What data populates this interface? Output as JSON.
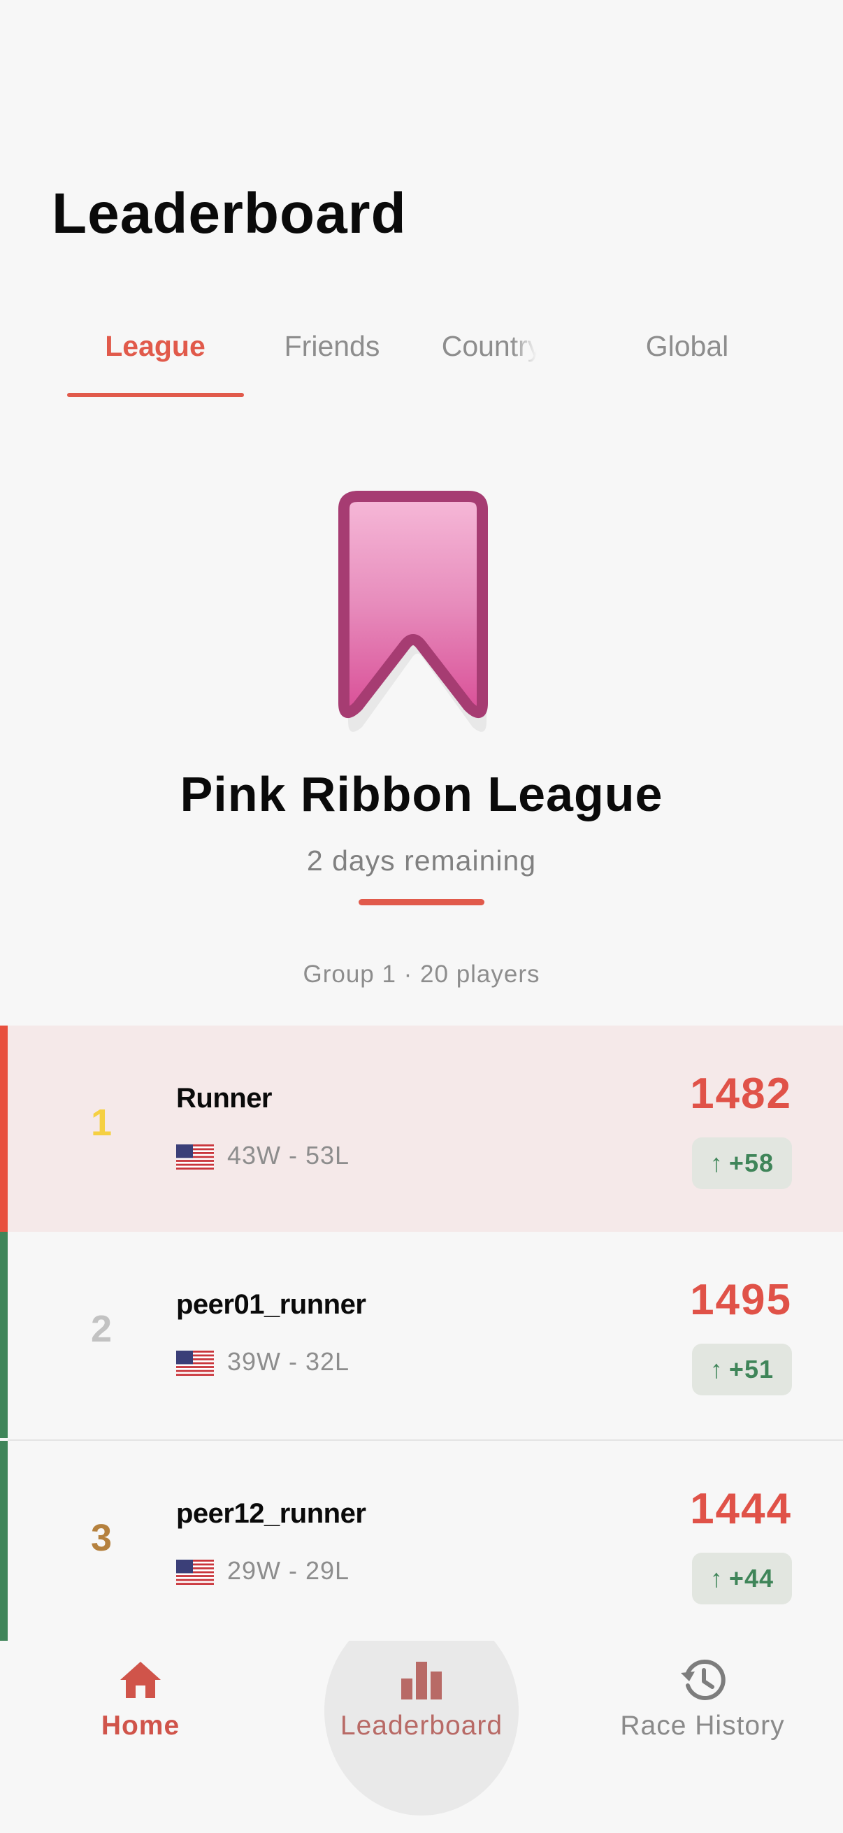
{
  "header": {
    "title": "Leaderboard"
  },
  "tabs": [
    {
      "label": "League",
      "active": true
    },
    {
      "label": "Friends",
      "active": false
    },
    {
      "label": "Country",
      "active": false
    },
    {
      "label": "Global",
      "active": false
    }
  ],
  "league": {
    "name": "Pink Ribbon League",
    "remaining": "2 days remaining",
    "group_info": "Group 1 · 20 players",
    "badge_icon": "ribbon-badge-icon"
  },
  "rows": [
    {
      "rank": "1",
      "name": "Runner",
      "record": "43W - 53L",
      "score": "1482",
      "delta": "+58",
      "flag_icon": "us-flag-icon",
      "is_me": true
    },
    {
      "rank": "2",
      "name": "peer01_runner",
      "record": "39W - 32L",
      "score": "1495",
      "delta": "+51",
      "flag_icon": "us-flag-icon",
      "is_me": false
    },
    {
      "rank": "3",
      "name": "peer12_runner",
      "record": "29W - 29L",
      "score": "1444",
      "delta": "+44",
      "flag_icon": "us-flag-icon",
      "is_me": false
    }
  ],
  "nav": [
    {
      "label": "Home",
      "icon": "home-icon",
      "active": false
    },
    {
      "label": "Leaderboard",
      "icon": "bar-chart-icon",
      "active": true
    },
    {
      "label": "Race History",
      "icon": "history-icon",
      "active": false
    }
  ],
  "colors": {
    "accent": "#e15a4b",
    "score": "#e05248",
    "positive": "#3f8559",
    "gold": "#f5d042",
    "silver": "#c2c2c2",
    "bronze": "#b5813e",
    "me_stripe": "#e8503e",
    "peer_stripe": "#3f8559"
  }
}
